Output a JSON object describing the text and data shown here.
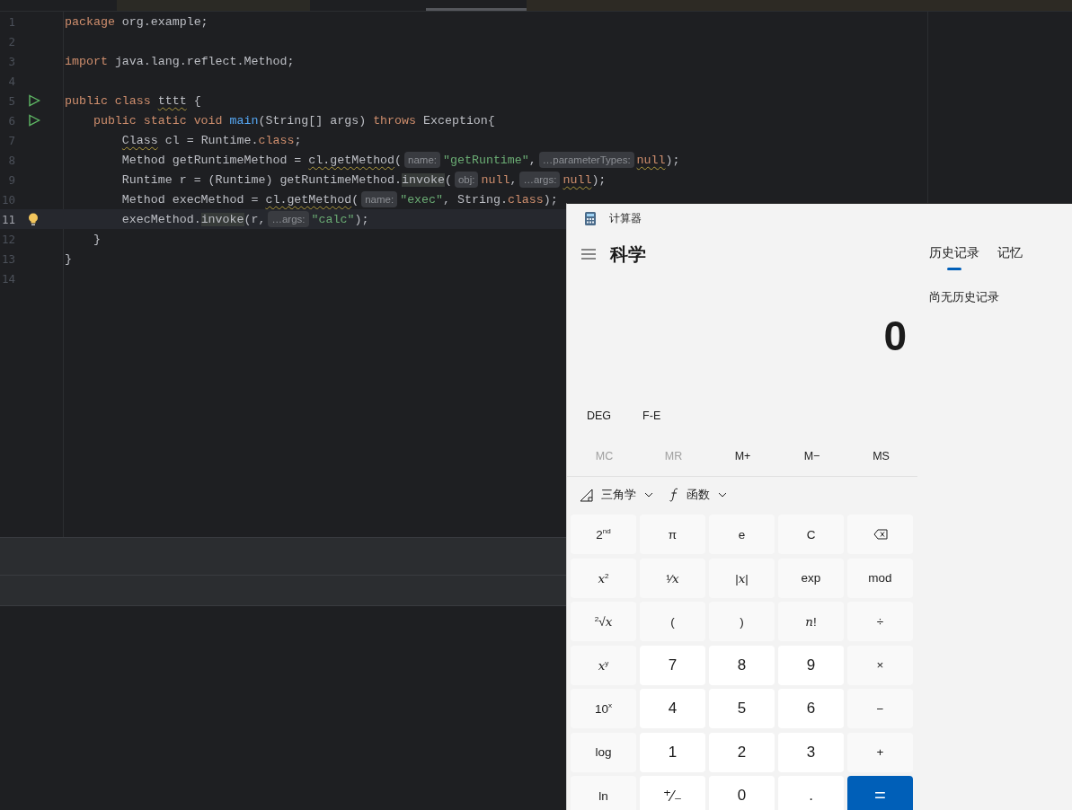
{
  "editor": {
    "lines": [
      {
        "number": "1",
        "current": false,
        "tokens": [
          {
            "kind": "kw",
            "text": "package"
          },
          {
            "kind": "plain",
            "text": " org.example;"
          }
        ]
      },
      {
        "number": "2",
        "current": false
      },
      {
        "number": "3",
        "current": false,
        "tokens": [
          {
            "kind": "kw",
            "text": "import"
          },
          {
            "kind": "plain",
            "text": " java.lang.reflect.Method;"
          }
        ]
      },
      {
        "number": "4",
        "current": false
      },
      {
        "number": "5",
        "current": false,
        "kind": "run",
        "tokens": [
          {
            "kind": "kw",
            "text": "public class "
          },
          {
            "kind": "warn",
            "text": "tttt"
          },
          {
            "kind": "plain",
            "text": " {"
          }
        ]
      },
      {
        "number": "6",
        "current": false,
        "kind": "run",
        "tokens": [
          {
            "kind": "kw",
            "text": "    public static void "
          },
          {
            "kind": "fn",
            "text": "main"
          },
          {
            "kind": "plain",
            "text": "(String[] args) "
          },
          {
            "kind": "kw",
            "text": "throws"
          },
          {
            "kind": "plain",
            "text": " Exception{"
          }
        ]
      },
      {
        "number": "7",
        "current": false,
        "tokens": [
          {
            "kind": "warn",
            "text": "        Class"
          },
          {
            "kind": "plain",
            "text": " cl = Runtime."
          },
          {
            "kind": "kw",
            "text": "class"
          },
          {
            "kind": "plain",
            "text": ";"
          }
        ]
      },
      {
        "number": "8",
        "current": false,
        "tokens": [
          {
            "kind": "plain",
            "text": "        Method getRuntimeMethod = "
          },
          {
            "kind": "warn",
            "text": "cl.getMethod"
          },
          {
            "kind": "plain",
            "text": "("
          },
          {
            "kind": "hint",
            "text": "name:"
          },
          {
            "kind": "str",
            "text": "\"getRuntime\""
          },
          {
            "kind": "plain",
            "text": ","
          },
          {
            "kind": "hint",
            "text": "…parameterTypes:"
          },
          {
            "kind": "warn-kw",
            "text": "null"
          },
          {
            "kind": "plain",
            "text": ");"
          }
        ]
      },
      {
        "number": "9",
        "current": false,
        "tokens": [
          {
            "kind": "plain",
            "text": "        Runtime r = (Runtime) getRuntimeMethod."
          },
          {
            "kind": "usage",
            "text": "invoke"
          },
          {
            "kind": "plain",
            "text": "("
          },
          {
            "kind": "hint",
            "text": "obj:"
          },
          {
            "kind": "kw",
            "text": "null"
          },
          {
            "kind": "plain",
            "text": ","
          },
          {
            "kind": "hint",
            "text": "…args:"
          },
          {
            "kind": "warn-kw",
            "text": "null"
          },
          {
            "kind": "plain",
            "text": ");"
          }
        ]
      },
      {
        "number": "10",
        "current": false,
        "tokens": [
          {
            "kind": "plain",
            "text": "        Method execMethod = "
          },
          {
            "kind": "warn",
            "text": "cl.getMethod"
          },
          {
            "kind": "plain",
            "text": "("
          },
          {
            "kind": "hint",
            "text": "name:"
          },
          {
            "kind": "str",
            "text": "\"exec\""
          },
          {
            "kind": "plain",
            "text": ", String."
          },
          {
            "kind": "kw",
            "text": "class"
          },
          {
            "kind": "plain",
            "text": ");"
          }
        ]
      },
      {
        "number": "11",
        "current": true,
        "kind": "bulb",
        "tokens": [
          {
            "kind": "plain",
            "text": "        execMethod."
          },
          {
            "kind": "usage",
            "text": "invoke"
          },
          {
            "kind": "plain",
            "text": "(r,"
          },
          {
            "kind": "hint",
            "text": "…args:"
          },
          {
            "kind": "str",
            "text": "\"calc\""
          },
          {
            "kind": "plain",
            "text": ");"
          }
        ]
      },
      {
        "number": "12",
        "current": false,
        "tokens": [
          {
            "kind": "plain",
            "text": "    }"
          }
        ]
      },
      {
        "number": "13",
        "current": false,
        "tokens": [
          {
            "kind": "plain",
            "text": "}"
          }
        ]
      },
      {
        "number": "14",
        "current": false
      }
    ]
  },
  "calculator": {
    "title": "计算器",
    "mode": "科学",
    "side_tabs": [
      {
        "label": "历史记录",
        "selected": true
      },
      {
        "label": "记忆",
        "selected": false
      }
    ],
    "history_empty": "尚无历史记录",
    "display": "0",
    "toggles": [
      "DEG",
      "F-E"
    ],
    "memory": [
      {
        "label": "MC",
        "disabled": true
      },
      {
        "label": "MR",
        "disabled": true
      },
      {
        "label": "M+",
        "disabled": false
      },
      {
        "label": "M−",
        "disabled": false
      },
      {
        "label": "MS",
        "disabled": false
      }
    ],
    "dropdowns": [
      {
        "kind": "trig",
        "label": "三角学"
      },
      {
        "kind": "func",
        "label": "函数"
      }
    ],
    "keys": [
      {
        "kind": "fn",
        "label": "2$^{nd}$"
      },
      {
        "kind": "fn",
        "label": "π"
      },
      {
        "kind": "fn",
        "label": "e"
      },
      {
        "kind": "fn",
        "label": "C"
      },
      {
        "kind": "backspace"
      },
      {
        "kind": "fn",
        "label": "*x*$^{2}$"
      },
      {
        "kind": "fn",
        "label": "¹⁄*x*"
      },
      {
        "kind": "fn",
        "label": "|*x*|"
      },
      {
        "kind": "fn",
        "label": "exp"
      },
      {
        "kind": "fn",
        "label": "mod"
      },
      {
        "kind": "fn",
        "label": "$^{2}$√*x*"
      },
      {
        "kind": "fn",
        "label": "("
      },
      {
        "kind": "fn",
        "label": ")"
      },
      {
        "kind": "fn",
        "label": "*n*!"
      },
      {
        "kind": "fn",
        "label": "÷"
      },
      {
        "kind": "fn",
        "label": "*x*$^{y}$"
      },
      {
        "kind": "num",
        "label": "7"
      },
      {
        "kind": "num",
        "label": "8"
      },
      {
        "kind": "num",
        "label": "9"
      },
      {
        "kind": "fn",
        "label": "×"
      },
      {
        "kind": "fn",
        "label": "10$^{x}$"
      },
      {
        "kind": "num",
        "label": "4"
      },
      {
        "kind": "num",
        "label": "5"
      },
      {
        "kind": "num",
        "label": "6"
      },
      {
        "kind": "fn",
        "label": "−"
      },
      {
        "kind": "fn",
        "label": "log"
      },
      {
        "kind": "num",
        "label": "1"
      },
      {
        "kind": "num",
        "label": "2"
      },
      {
        "kind": "num",
        "label": "3"
      },
      {
        "kind": "fn",
        "label": "+"
      },
      {
        "kind": "fn",
        "label": "ln"
      },
      {
        "kind": "num",
        "label": "⁺⁄₋"
      },
      {
        "kind": "num",
        "label": "0"
      },
      {
        "kind": "num",
        "label": "."
      },
      {
        "kind": "eq",
        "label": "="
      }
    ]
  }
}
